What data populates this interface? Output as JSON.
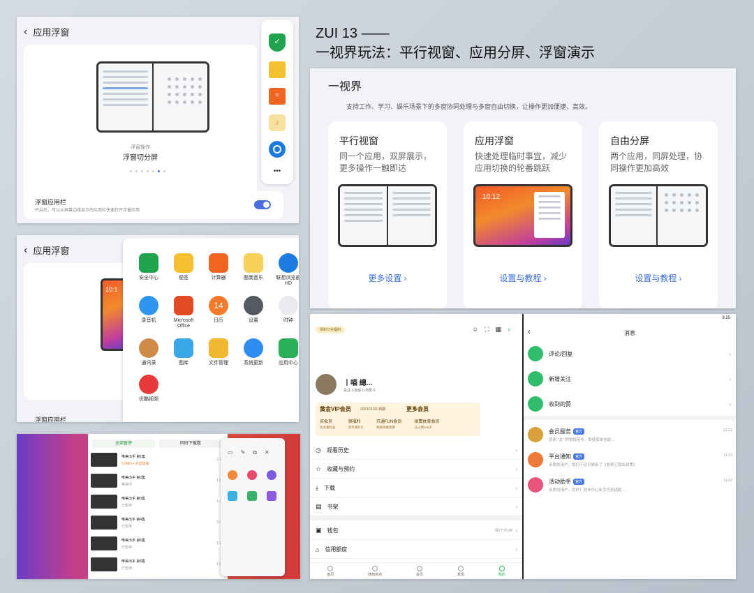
{
  "heading": {
    "line1": "ZUI 13 ——",
    "line2": "一视界玩法：平行视窗、应用分屏、浮窗演示"
  },
  "panel1": {
    "title": "应用浮窗",
    "caption_small": "浮窗操作",
    "caption": "浮窗切分屏",
    "setting_title": "浮窗应用栏",
    "setting_desc": "开启后，可以从屏幕边缘显示的应用栏快速打开浮窗应用",
    "more": "•••"
  },
  "panel2": {
    "title": "应用浮窗",
    "bottom_label": "浮窗应用栏",
    "clock": "10:1",
    "apps": [
      {
        "label": "安全中心",
        "icon": "shield-icon",
        "color": "#20a34d"
      },
      {
        "label": "便签",
        "icon": "notes-icon",
        "color": "#f5c12e"
      },
      {
        "label": "计算器",
        "icon": "calculator-icon",
        "color": "#f06422"
      },
      {
        "label": "酷我音乐",
        "icon": "music-icon",
        "color": "#f7d15a"
      },
      {
        "label": "联想浏览器HD",
        "icon": "browser-icon",
        "color": "#1c7be0"
      },
      {
        "label": "录音机",
        "icon": "recorder-icon",
        "color": "#2e96f0"
      },
      {
        "label": "Microsoft Office",
        "icon": "office-icon",
        "color": "#e24a24"
      },
      {
        "label": "日历",
        "icon": "calendar-icon",
        "color": "#f4792a",
        "text": "14"
      },
      {
        "label": "设置",
        "icon": "settings-icon",
        "color": "#555a60"
      },
      {
        "label": "时钟",
        "icon": "clock-icon",
        "color": "#e8eaee"
      },
      {
        "label": "通讯录",
        "icon": "contacts-icon",
        "color": "#d08a4a"
      },
      {
        "label": "图库",
        "icon": "gallery-icon",
        "color": "#3aa8e8"
      },
      {
        "label": "文件管理",
        "icon": "folder-icon",
        "color": "#f2b731"
      },
      {
        "label": "系统更新",
        "icon": "update-icon",
        "color": "#2d8ef0"
      },
      {
        "label": "应用中心",
        "icon": "appstore-icon",
        "color": "#2bb05a"
      },
      {
        "label": "优酷视频",
        "icon": "youku-icon",
        "color": "#e83a3a"
      }
    ]
  },
  "panel3": {
    "tabs": [
      "全部暂停",
      "同时下载数"
    ],
    "videos": [
      {
        "title": "唯美出手 第1集",
        "sub": "0.9M/s • 点击加速"
      },
      {
        "title": "唯美出手 第2集",
        "sub": "等待中"
      },
      {
        "title": "唯美出手 第3集",
        "sub": "已暂停"
      },
      {
        "title": "唯美出手 第4集",
        "sub": "已暂停"
      },
      {
        "title": "唯美出手 第5集",
        "sub": "已暂停"
      },
      {
        "title": "唯美出手 第6集",
        "sub": "已暂停"
      }
    ],
    "sizes": [
      "2.15",
      "1.85",
      "1.96",
      "2.05",
      "1.95",
      "1.80"
    ]
  },
  "panel4": {
    "title": "一视界",
    "desc": "支持工作、学习、娱乐场景下的多窗协同处理与多窗自由切换，让操作更加便捷、高效。",
    "features": [
      {
        "title": "平行视窗",
        "desc": "同一个应用，双屏展示，更多操作一触即达",
        "link": "更多设置"
      },
      {
        "title": "应用浮窗",
        "desc": "快速处理临时事宜，减少应用切换的轮番跳跃",
        "link": "设置与教程"
      },
      {
        "title": "自由分屏",
        "desc": "两个应用，同屏处理，协同操作更加高效",
        "link": "设置与教程"
      }
    ],
    "clock": "10:12"
  },
  "panel5": {
    "status_time": "9:25",
    "badge": "领积分兑福利",
    "username": "丨喵 總...",
    "stats": "关注 1   粉丝 0   点赞 0",
    "vip_left": "黄金VIP会员",
    "vip_date": "2022/11/26 到期",
    "vip_right": "更多会员",
    "vip_items": [
      {
        "t": "买会员",
        "s": "享多重权益"
      },
      {
        "t": "领福利",
        "s": "领专属好礼"
      },
      {
        "t": "开通FUN会员",
        "s": "畅看神番速看"
      },
      {
        "t": "续费体育会员",
        "s": "已过期166天"
      }
    ],
    "menu": [
      "观看历史",
      "收藏与预约",
      "下载",
      "书架"
    ],
    "menu2": [
      {
        "t": "钱包",
        "r": "领2个月VIP"
      },
      {
        "t": "信用额度",
        "r": ""
      }
    ],
    "nav": [
      "首页",
      "随刻热点",
      "会员",
      "发现",
      "我的"
    ],
    "msg_title": "消息",
    "msgs": [
      {
        "t": "评论/回复",
        "c": "#2fbd6b"
      },
      {
        "t": "新增关注",
        "c": "#2fbd6b"
      },
      {
        "t": "收到的赞",
        "c": "#2fbd6b"
      }
    ],
    "notices": [
      {
        "t": "会员服务",
        "tag": "官方",
        "d": "12-12",
        "s": "感谢 “龙” 的悄悄陪伴，即使孤单也能…",
        "c": "#d8a03a"
      },
      {
        "t": "平台通知",
        "tag": "官方",
        "d": "11-23",
        "s": "亲爱的用户，我们于近日更新了《爱奇艺隐私政策》",
        "c": "#f07a3a"
      },
      {
        "t": "活动助手",
        "tag": "官方",
        "d": "11-02",
        "s": "亲爱的用户，您好！创作中心新手任务适配…",
        "c": "#e8557a"
      }
    ]
  }
}
